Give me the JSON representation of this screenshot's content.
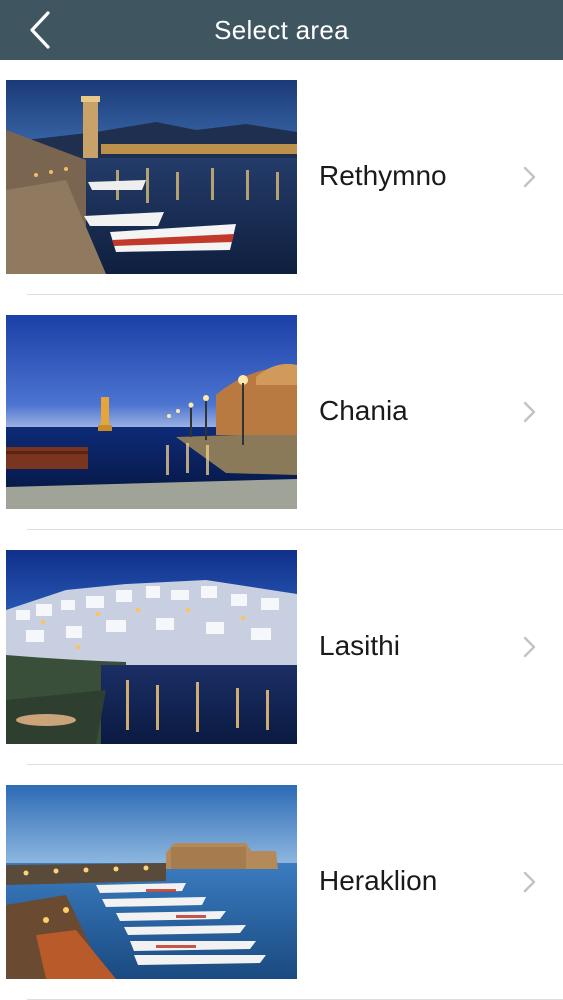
{
  "nav": {
    "title": "Select area",
    "back_icon": "chevron-left-icon"
  },
  "areas": [
    {
      "name": "Rethymno",
      "icon": "chevron-right-icon"
    },
    {
      "name": "Chania",
      "icon": "chevron-right-icon"
    },
    {
      "name": "Lasithi",
      "icon": "chevron-right-icon"
    },
    {
      "name": "Heraklion",
      "icon": "chevron-right-icon"
    }
  ],
  "colors": {
    "navbar": "#3f5560",
    "text": "#1a1a1a",
    "chevron": "#c2c2c7",
    "divider": "#dedede"
  }
}
